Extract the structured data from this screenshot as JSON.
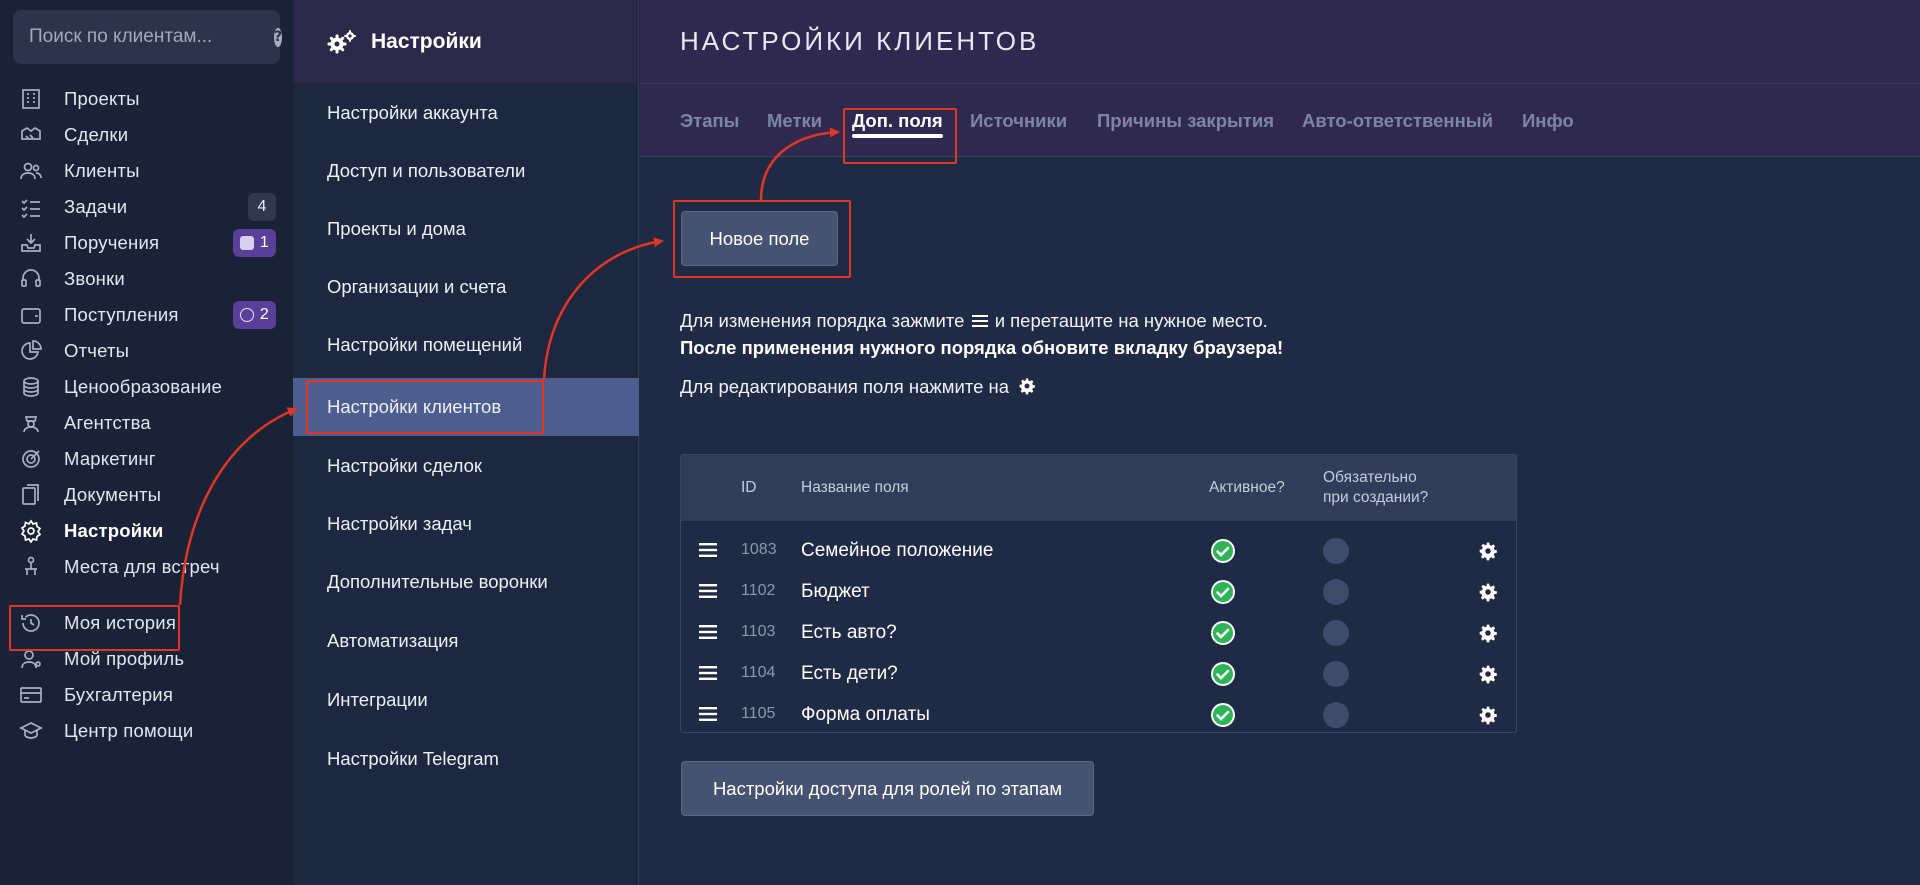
{
  "search": {
    "placeholder": "Поиск по клиентам..."
  },
  "sidebar": {
    "items": [
      {
        "label": "Проекты",
        "icon": "building-icon"
      },
      {
        "label": "Сделки",
        "icon": "handshake-icon"
      },
      {
        "label": "Клиенты",
        "icon": "users-icon"
      },
      {
        "label": "Задачи",
        "icon": "tasks-icon",
        "badge": "4"
      },
      {
        "label": "Поручения",
        "icon": "inbox-icon",
        "badge": "1"
      },
      {
        "label": "Звонки",
        "icon": "headset-icon"
      },
      {
        "label": "Поступления",
        "icon": "wallet-icon",
        "badge": "2"
      },
      {
        "label": "Отчеты",
        "icon": "pie-chart-icon"
      },
      {
        "label": "Ценообразование",
        "icon": "coins-icon"
      },
      {
        "label": "Агентства",
        "icon": "agent-icon"
      },
      {
        "label": "Маркетинг",
        "icon": "target-icon"
      },
      {
        "label": "Документы",
        "icon": "documents-icon"
      },
      {
        "label": "Настройки",
        "icon": "gear-icon",
        "active": true
      },
      {
        "label": "Места для встреч",
        "icon": "meeting-icon"
      },
      {
        "label": "Моя история",
        "icon": "history-icon"
      },
      {
        "label": "Мой профиль",
        "icon": "profile-icon"
      },
      {
        "label": "Бухгалтерия",
        "icon": "card-icon"
      },
      {
        "label": "Центр помощи",
        "icon": "graduation-icon"
      }
    ]
  },
  "settings": {
    "title": "Настройки",
    "items": [
      "Настройки аккаунта",
      "Доступ и пользователи",
      "Проекты и дома",
      "Организации и счета",
      "Настройки помещений",
      "Настройки клиентов",
      "Настройки сделок",
      "Настройки задач",
      "Дополнительные воронки",
      "Автоматизация",
      "Интеграции",
      "Настройки Telegram"
    ],
    "active_index": 5
  },
  "main": {
    "title": "НАСТРОЙКИ КЛИЕНТОВ",
    "tabs": [
      "Этапы",
      "Метки",
      "Доп. поля",
      "Источники",
      "Причины закрытия",
      "Авто-ответственный",
      "Инфо"
    ],
    "active_tab": 2,
    "new_field_button": "Новое поле",
    "info_line1_a": "Для изменения порядка зажмите",
    "info_line1_b": "и перетащите на нужное место.",
    "info_line2": "После применения нужного порядка обновите вкладку браузера!",
    "info_line3": "Для редактирования поля нажмите на",
    "table": {
      "headers": {
        "id": "ID",
        "name": "Название поля",
        "active": "Активное?",
        "required_1": "Обязательно",
        "required_2": "при создании?"
      },
      "rows": [
        {
          "id": "1083",
          "name": "Семейное положение",
          "active": true,
          "required": false
        },
        {
          "id": "1102",
          "name": "Бюджет",
          "active": true,
          "required": false
        },
        {
          "id": "1103",
          "name": "Есть авто?",
          "active": true,
          "required": false
        },
        {
          "id": "1104",
          "name": "Есть дети?",
          "active": true,
          "required": false
        },
        {
          "id": "1105",
          "name": "Форма оплаты",
          "active": true,
          "required": false
        }
      ]
    },
    "roles_button": "Настройки доступа для ролей по этапам"
  },
  "colors": {
    "accent_active": "#4d5e8e",
    "annotation": "#e23523",
    "check_green": "#2fb457",
    "badge_purple": "#5a3f99"
  }
}
